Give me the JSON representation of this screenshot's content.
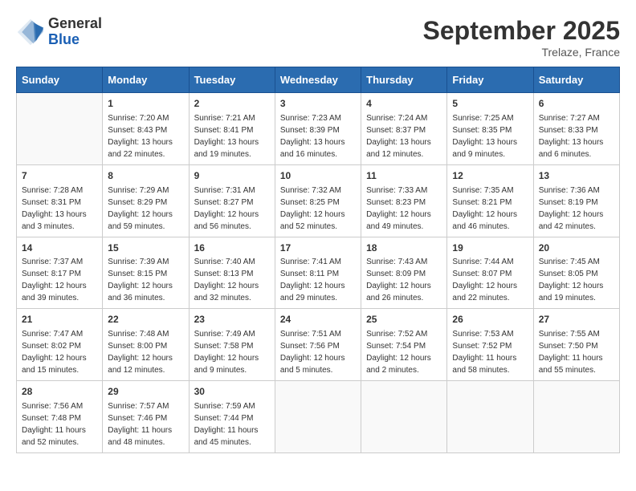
{
  "header": {
    "logo_general": "General",
    "logo_blue": "Blue",
    "month_title": "September 2025",
    "location": "Trelaze, France"
  },
  "days_of_week": [
    "Sunday",
    "Monday",
    "Tuesday",
    "Wednesday",
    "Thursday",
    "Friday",
    "Saturday"
  ],
  "weeks": [
    [
      {
        "day": "",
        "sunrise": "",
        "sunset": "",
        "daylight": ""
      },
      {
        "day": "1",
        "sunrise": "Sunrise: 7:20 AM",
        "sunset": "Sunset: 8:43 PM",
        "daylight": "Daylight: 13 hours and 22 minutes."
      },
      {
        "day": "2",
        "sunrise": "Sunrise: 7:21 AM",
        "sunset": "Sunset: 8:41 PM",
        "daylight": "Daylight: 13 hours and 19 minutes."
      },
      {
        "day": "3",
        "sunrise": "Sunrise: 7:23 AM",
        "sunset": "Sunset: 8:39 PM",
        "daylight": "Daylight: 13 hours and 16 minutes."
      },
      {
        "day": "4",
        "sunrise": "Sunrise: 7:24 AM",
        "sunset": "Sunset: 8:37 PM",
        "daylight": "Daylight: 13 hours and 12 minutes."
      },
      {
        "day": "5",
        "sunrise": "Sunrise: 7:25 AM",
        "sunset": "Sunset: 8:35 PM",
        "daylight": "Daylight: 13 hours and 9 minutes."
      },
      {
        "day": "6",
        "sunrise": "Sunrise: 7:27 AM",
        "sunset": "Sunset: 8:33 PM",
        "daylight": "Daylight: 13 hours and 6 minutes."
      }
    ],
    [
      {
        "day": "7",
        "sunrise": "Sunrise: 7:28 AM",
        "sunset": "Sunset: 8:31 PM",
        "daylight": "Daylight: 13 hours and 3 minutes."
      },
      {
        "day": "8",
        "sunrise": "Sunrise: 7:29 AM",
        "sunset": "Sunset: 8:29 PM",
        "daylight": "Daylight: 12 hours and 59 minutes."
      },
      {
        "day": "9",
        "sunrise": "Sunrise: 7:31 AM",
        "sunset": "Sunset: 8:27 PM",
        "daylight": "Daylight: 12 hours and 56 minutes."
      },
      {
        "day": "10",
        "sunrise": "Sunrise: 7:32 AM",
        "sunset": "Sunset: 8:25 PM",
        "daylight": "Daylight: 12 hours and 52 minutes."
      },
      {
        "day": "11",
        "sunrise": "Sunrise: 7:33 AM",
        "sunset": "Sunset: 8:23 PM",
        "daylight": "Daylight: 12 hours and 49 minutes."
      },
      {
        "day": "12",
        "sunrise": "Sunrise: 7:35 AM",
        "sunset": "Sunset: 8:21 PM",
        "daylight": "Daylight: 12 hours and 46 minutes."
      },
      {
        "day": "13",
        "sunrise": "Sunrise: 7:36 AM",
        "sunset": "Sunset: 8:19 PM",
        "daylight": "Daylight: 12 hours and 42 minutes."
      }
    ],
    [
      {
        "day": "14",
        "sunrise": "Sunrise: 7:37 AM",
        "sunset": "Sunset: 8:17 PM",
        "daylight": "Daylight: 12 hours and 39 minutes."
      },
      {
        "day": "15",
        "sunrise": "Sunrise: 7:39 AM",
        "sunset": "Sunset: 8:15 PM",
        "daylight": "Daylight: 12 hours and 36 minutes."
      },
      {
        "day": "16",
        "sunrise": "Sunrise: 7:40 AM",
        "sunset": "Sunset: 8:13 PM",
        "daylight": "Daylight: 12 hours and 32 minutes."
      },
      {
        "day": "17",
        "sunrise": "Sunrise: 7:41 AM",
        "sunset": "Sunset: 8:11 PM",
        "daylight": "Daylight: 12 hours and 29 minutes."
      },
      {
        "day": "18",
        "sunrise": "Sunrise: 7:43 AM",
        "sunset": "Sunset: 8:09 PM",
        "daylight": "Daylight: 12 hours and 26 minutes."
      },
      {
        "day": "19",
        "sunrise": "Sunrise: 7:44 AM",
        "sunset": "Sunset: 8:07 PM",
        "daylight": "Daylight: 12 hours and 22 minutes."
      },
      {
        "day": "20",
        "sunrise": "Sunrise: 7:45 AM",
        "sunset": "Sunset: 8:05 PM",
        "daylight": "Daylight: 12 hours and 19 minutes."
      }
    ],
    [
      {
        "day": "21",
        "sunrise": "Sunrise: 7:47 AM",
        "sunset": "Sunset: 8:02 PM",
        "daylight": "Daylight: 12 hours and 15 minutes."
      },
      {
        "day": "22",
        "sunrise": "Sunrise: 7:48 AM",
        "sunset": "Sunset: 8:00 PM",
        "daylight": "Daylight: 12 hours and 12 minutes."
      },
      {
        "day": "23",
        "sunrise": "Sunrise: 7:49 AM",
        "sunset": "Sunset: 7:58 PM",
        "daylight": "Daylight: 12 hours and 9 minutes."
      },
      {
        "day": "24",
        "sunrise": "Sunrise: 7:51 AM",
        "sunset": "Sunset: 7:56 PM",
        "daylight": "Daylight: 12 hours and 5 minutes."
      },
      {
        "day": "25",
        "sunrise": "Sunrise: 7:52 AM",
        "sunset": "Sunset: 7:54 PM",
        "daylight": "Daylight: 12 hours and 2 minutes."
      },
      {
        "day": "26",
        "sunrise": "Sunrise: 7:53 AM",
        "sunset": "Sunset: 7:52 PM",
        "daylight": "Daylight: 11 hours and 58 minutes."
      },
      {
        "day": "27",
        "sunrise": "Sunrise: 7:55 AM",
        "sunset": "Sunset: 7:50 PM",
        "daylight": "Daylight: 11 hours and 55 minutes."
      }
    ],
    [
      {
        "day": "28",
        "sunrise": "Sunrise: 7:56 AM",
        "sunset": "Sunset: 7:48 PM",
        "daylight": "Daylight: 11 hours and 52 minutes."
      },
      {
        "day": "29",
        "sunrise": "Sunrise: 7:57 AM",
        "sunset": "Sunset: 7:46 PM",
        "daylight": "Daylight: 11 hours and 48 minutes."
      },
      {
        "day": "30",
        "sunrise": "Sunrise: 7:59 AM",
        "sunset": "Sunset: 7:44 PM",
        "daylight": "Daylight: 11 hours and 45 minutes."
      },
      {
        "day": "",
        "sunrise": "",
        "sunset": "",
        "daylight": ""
      },
      {
        "day": "",
        "sunrise": "",
        "sunset": "",
        "daylight": ""
      },
      {
        "day": "",
        "sunrise": "",
        "sunset": "",
        "daylight": ""
      },
      {
        "day": "",
        "sunrise": "",
        "sunset": "",
        "daylight": ""
      }
    ]
  ]
}
